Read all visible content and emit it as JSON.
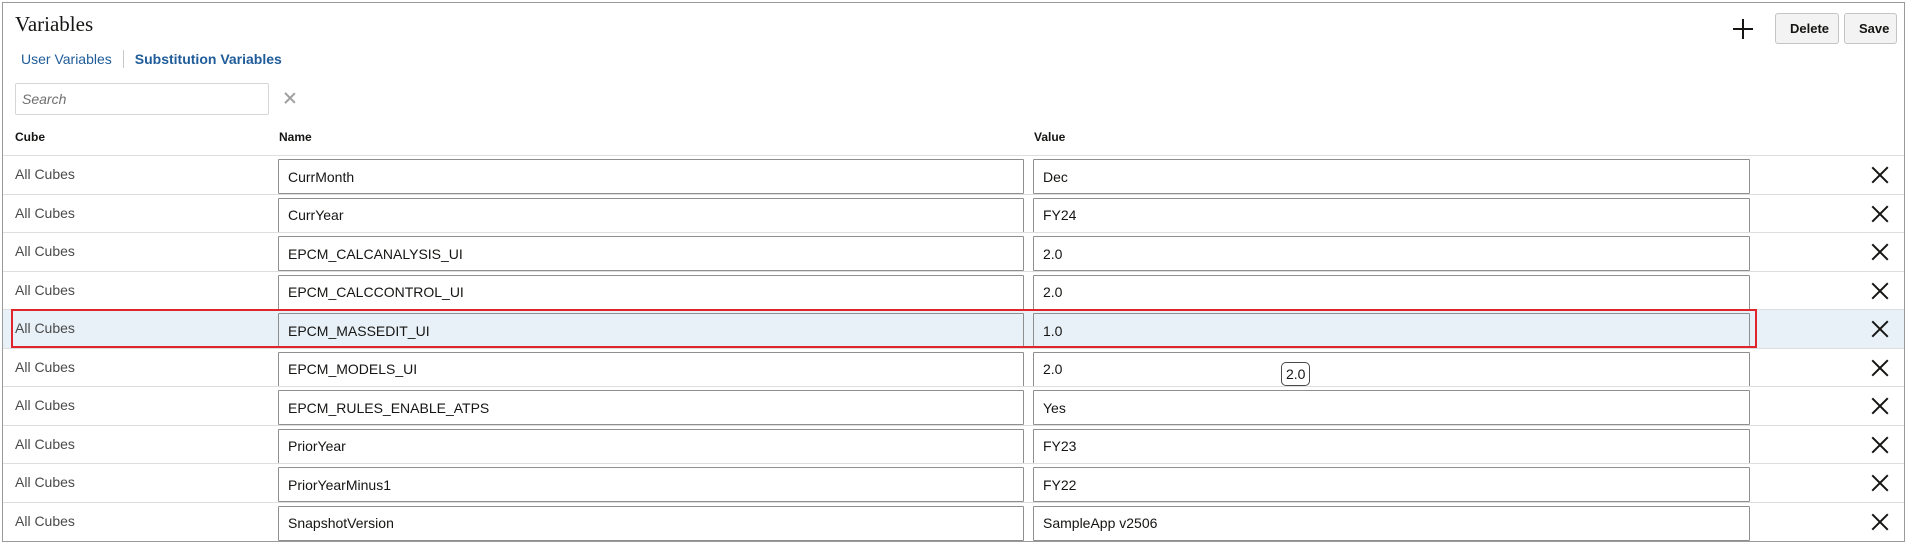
{
  "page": {
    "title": "Variables"
  },
  "tabs": [
    {
      "label": "User Variables",
      "active": false
    },
    {
      "label": "Substitution Variables",
      "active": true
    }
  ],
  "toolbar": {
    "add_icon": "plus-icon",
    "delete_label": "Delete",
    "save_label": "Save"
  },
  "search": {
    "placeholder": "Search",
    "value": "",
    "clear_icon": "close-icon"
  },
  "columns": {
    "cube": "Cube",
    "name": "Name",
    "value": "Value"
  },
  "rows": [
    {
      "cube": "All Cubes",
      "name": "CurrMonth",
      "value": "Dec"
    },
    {
      "cube": "All Cubes",
      "name": "CurrYear",
      "value": "FY24"
    },
    {
      "cube": "All Cubes",
      "name": "EPCM_CALCANALYSIS_UI",
      "value": "2.0"
    },
    {
      "cube": "All Cubes",
      "name": "EPCM_CALCCONTROL_UI",
      "value": "2.0"
    },
    {
      "cube": "All Cubes",
      "name": "EPCM_MASSEDIT_UI",
      "value": "1.0",
      "selected": true
    },
    {
      "cube": "All Cubes",
      "name": "EPCM_MODELS_UI",
      "value": "2.0"
    },
    {
      "cube": "All Cubes",
      "name": "EPCM_RULES_ENABLE_ATPS",
      "value": "Yes"
    },
    {
      "cube": "All Cubes",
      "name": "PriorYear",
      "value": "FY23"
    },
    {
      "cube": "All Cubes",
      "name": "PriorYearMinus1",
      "value": "FY22"
    },
    {
      "cube": "All Cubes",
      "name": "SnapshotVersion",
      "value": "SampleApp v2506"
    }
  ],
  "row_delete_icon": "close-icon",
  "tooltip": {
    "text": "2.0"
  },
  "colors": {
    "link": "#1f5c99",
    "selected_row": "#e8f1f8",
    "highlight_border": "#e0242b"
  }
}
